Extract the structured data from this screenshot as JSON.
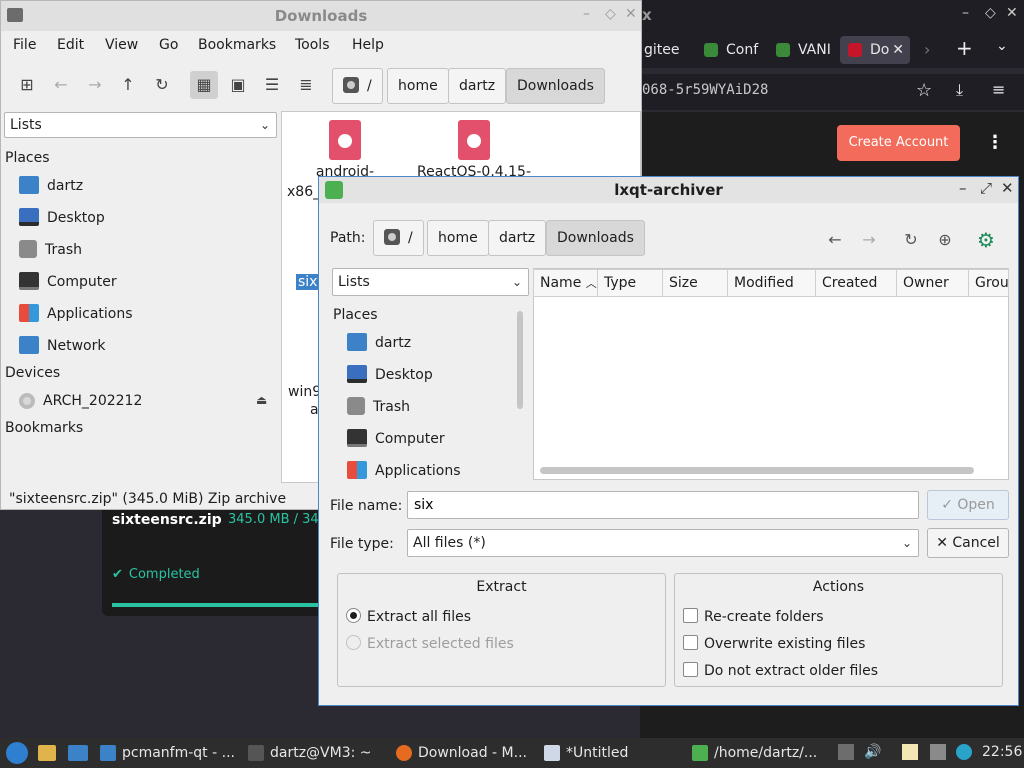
{
  "browser": {
    "tab_labels": [
      "gitee",
      "Conf",
      "VANI",
      "Do"
    ],
    "url_fragment": "068-5r59WYAiD28",
    "create_account": "Create Account",
    "download": {
      "filename": "sixteensrc.zip",
      "size": "345.0 MB",
      "size_more": "34",
      "status": "Completed",
      "progress": 1.0
    }
  },
  "pcmanfm": {
    "title": "Downloads",
    "menu": [
      "File",
      "Edit",
      "View",
      "Go",
      "Bookmarks",
      "Tools",
      "Help"
    ],
    "path": [
      "/",
      "home",
      "dartz",
      "Downloads"
    ],
    "side_mode": "Lists",
    "places_header": "Places",
    "places": [
      "dartz",
      "Desktop",
      "Trash",
      "Computer",
      "Applications",
      "Network"
    ],
    "devices_header": "Devices",
    "devices": [
      "ARCH_202212"
    ],
    "bookmarks_header": "Bookmarks",
    "files": [
      "android-",
      "ReactOS-0.4.15-",
      "x86_",
      "sixt",
      "win9",
      "a"
    ],
    "status": "\"sixteensrc.zip\" (345.0 MiB) Zip archive"
  },
  "archiver": {
    "title": "lxqt-archiver",
    "path_label": "Path:",
    "path": [
      "/",
      "home",
      "dartz",
      "Downloads"
    ],
    "side_mode": "Lists",
    "places_header": "Places",
    "places": [
      "dartz",
      "Desktop",
      "Trash",
      "Computer",
      "Applications"
    ],
    "columns": [
      "Name",
      "Type",
      "Size",
      "Modified",
      "Created",
      "Owner",
      "Grou"
    ],
    "file_name_label": "File name:",
    "file_name_value": "six",
    "file_type_label": "File type:",
    "file_type_value": "All files (*)",
    "open_label": "Open",
    "cancel_label": "Cancel",
    "extract": {
      "title": "Extract",
      "all": "Extract all files",
      "selected": "Extract selected files"
    },
    "actions": {
      "title": "Actions",
      "recreate": "Re-create folders",
      "overwrite": "Overwrite existing files",
      "older": "Do not extract older files"
    }
  },
  "taskbar": {
    "tasks": [
      "pcmanfm-qt - ...",
      "dartz@VM3: ~",
      "Download - M...",
      "*Untitled",
      "/home/dartz/..."
    ],
    "clock": "22:56"
  }
}
